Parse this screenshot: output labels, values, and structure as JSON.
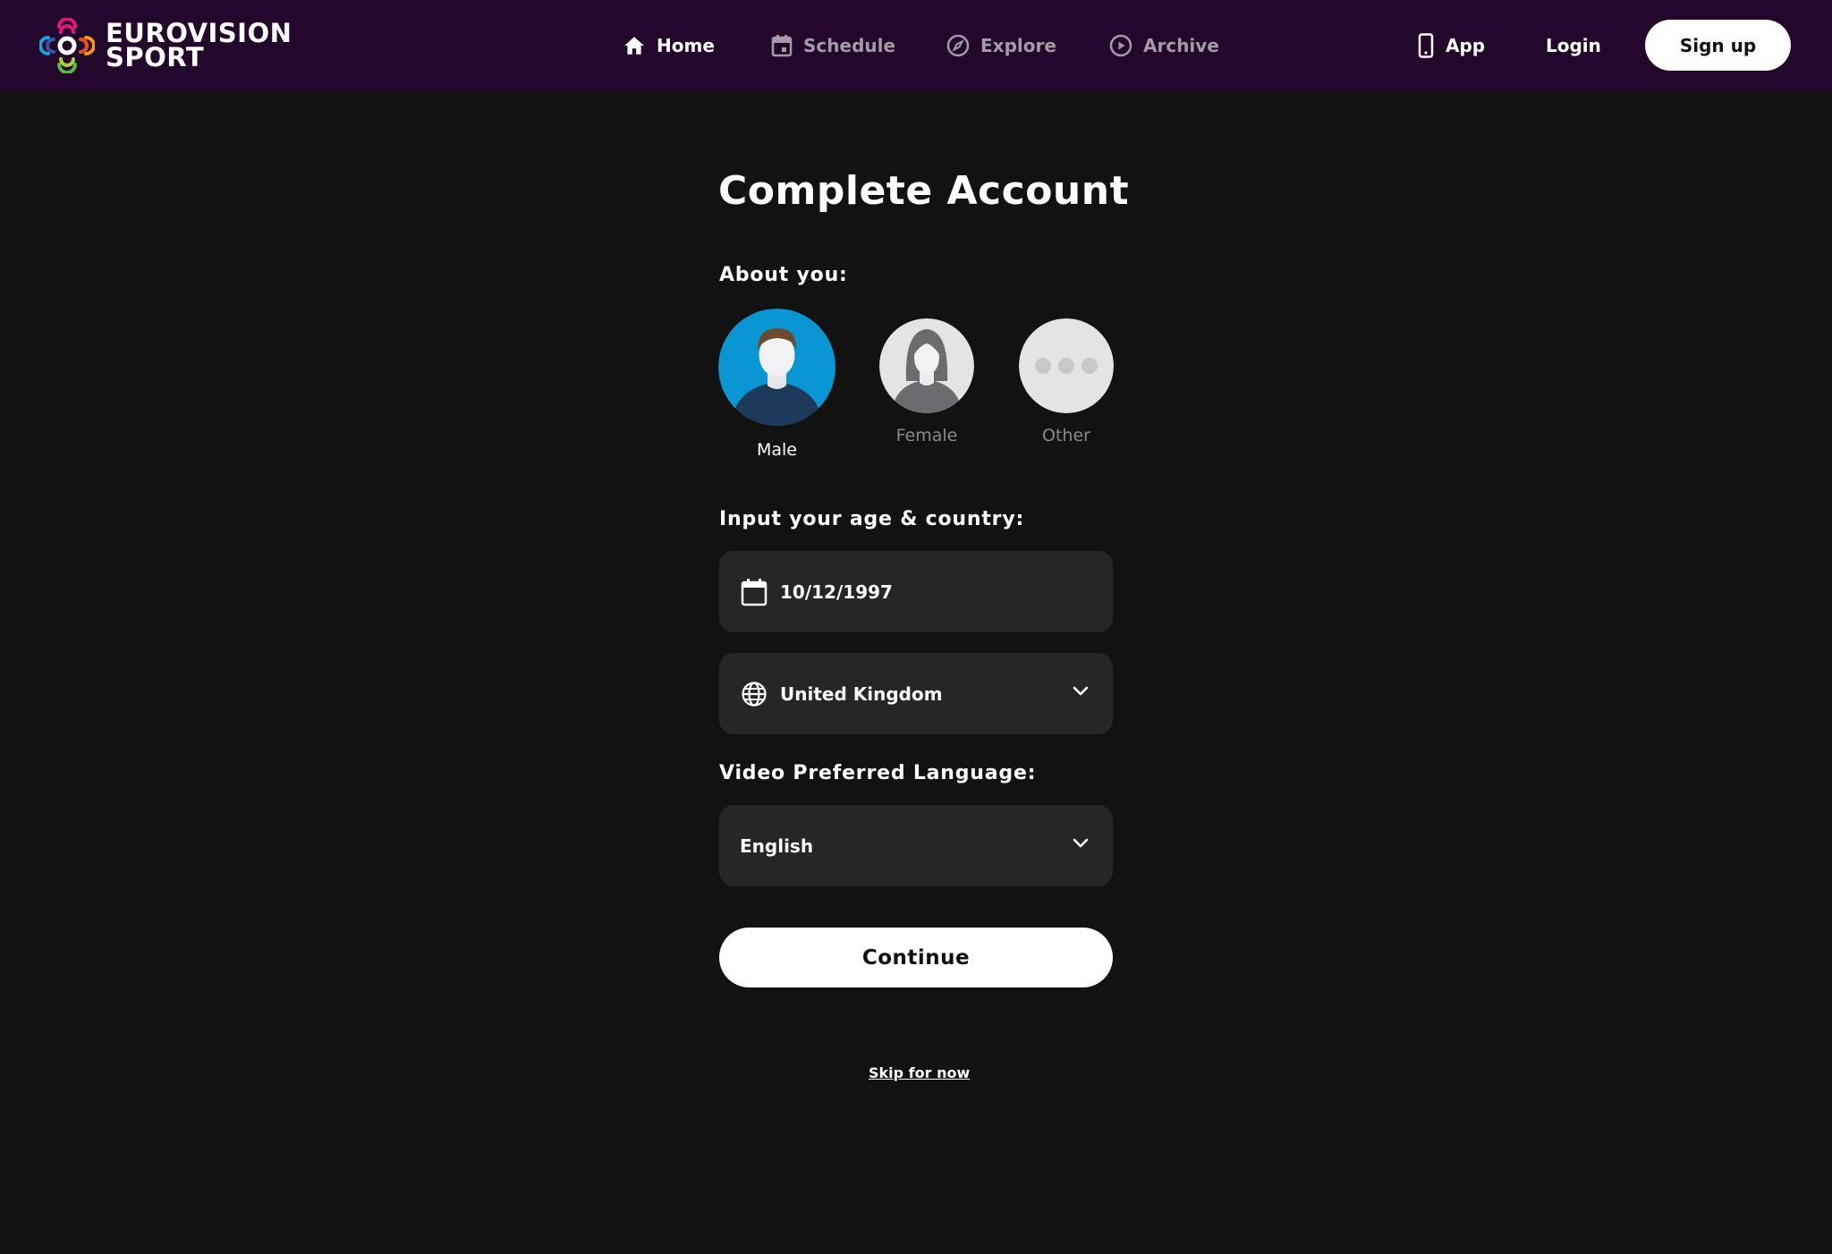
{
  "header": {
    "logo_line1": "EUROVISION",
    "logo_line2": "SPORT",
    "nav": [
      {
        "label": "Home",
        "icon": "home-icon",
        "active": true
      },
      {
        "label": "Schedule",
        "icon": "calendar-icon",
        "active": false
      },
      {
        "label": "Explore",
        "icon": "compass-icon",
        "active": false
      },
      {
        "label": "Archive",
        "icon": "play-circle-icon",
        "active": false
      }
    ],
    "app_label": "App",
    "login_label": "Login",
    "signup_label": "Sign up"
  },
  "form": {
    "title": "Complete Account",
    "about_label": "About you:",
    "genders": [
      {
        "label": "Male",
        "selected": true
      },
      {
        "label": "Female",
        "selected": false
      },
      {
        "label": "Other",
        "selected": false
      }
    ],
    "age_country_label": "Input your age & country:",
    "birthdate_value": "10/12/1997",
    "country_value": "United Kingdom",
    "language_label": "Video Preferred Language:",
    "language_value": "English",
    "continue_label": "Continue",
    "skip_label": "Skip for now"
  },
  "colors": {
    "header_bg": "#24082c",
    "page_bg": "#121212",
    "field_bg": "#262626",
    "male_avatar_bg": "#0a96d2",
    "inactive_nav": "#a49aa8"
  }
}
